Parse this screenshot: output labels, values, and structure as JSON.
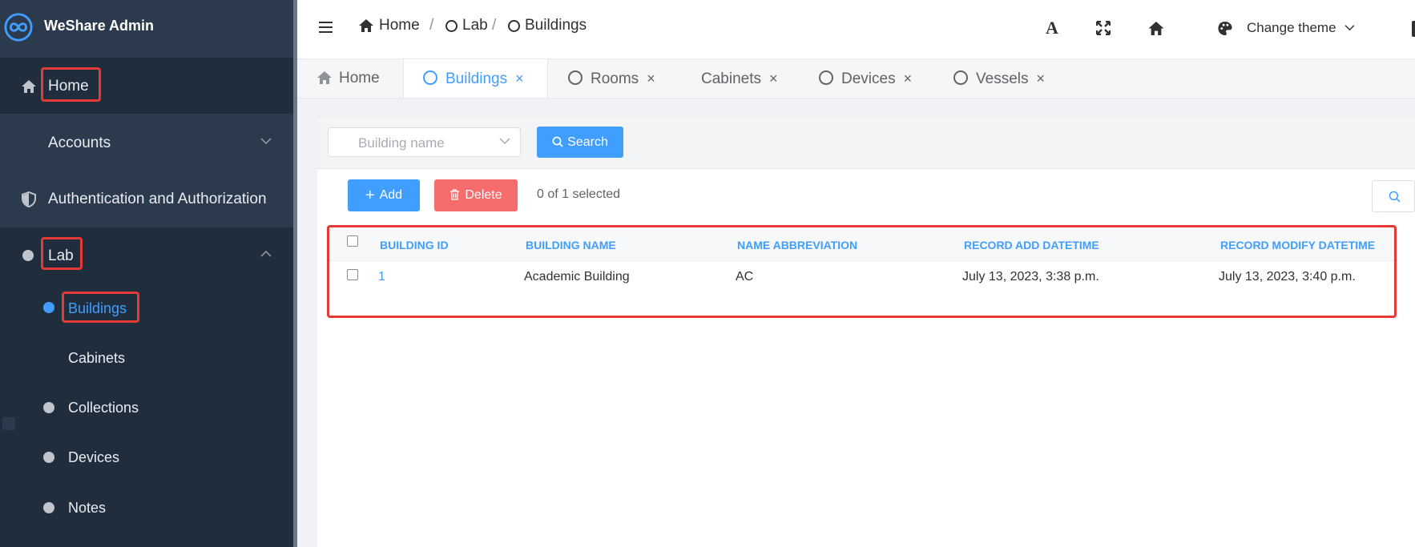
{
  "app": {
    "brand": "WeShare Admin"
  },
  "sidebar": {
    "items": [
      {
        "label": "Home",
        "icon": "home-icon"
      },
      {
        "label": "Accounts",
        "icon": "chevron-down-icon"
      },
      {
        "label": "Authentication and Authorization",
        "icon": "shield-icon"
      },
      {
        "label": "Lab",
        "icon": "chevron-up-icon"
      },
      {
        "label": "Buildings"
      },
      {
        "label": "Cabinets"
      },
      {
        "label": "Collections"
      },
      {
        "label": "Devices"
      },
      {
        "label": "Notes"
      }
    ]
  },
  "breadcrumb": [
    "Home",
    "/",
    "Lab",
    "/",
    "Buildings"
  ],
  "header": {
    "change_theme": "Change theme"
  },
  "tabs": [
    {
      "label": "Home"
    },
    {
      "label": "Buildings"
    },
    {
      "label": "Rooms"
    },
    {
      "label": "Cabinets"
    },
    {
      "label": "Devices"
    },
    {
      "label": "Vessels"
    }
  ],
  "filter": {
    "placeholder": "Building name",
    "search_label": "Search"
  },
  "actions": {
    "add_label": "Add",
    "delete_label": "Delete",
    "selected_text": "0 of 1 selected"
  },
  "table": {
    "columns": [
      "BUILDING ID",
      "BUILDING NAME",
      "NAME ABBREVIATION",
      "RECORD ADD DATETIME",
      "RECORD MODIFY DATETIME"
    ],
    "rows": [
      [
        "1",
        "Academic Building",
        "AC",
        "July 13, 2023, 3:38 p.m.",
        "July 13, 2023, 3:40 p.m."
      ]
    ]
  },
  "colors": {
    "accent": "#409eff",
    "danger": "#f56c6c",
    "sidebar": "#1f2d3d",
    "highlight": "#e53935"
  }
}
